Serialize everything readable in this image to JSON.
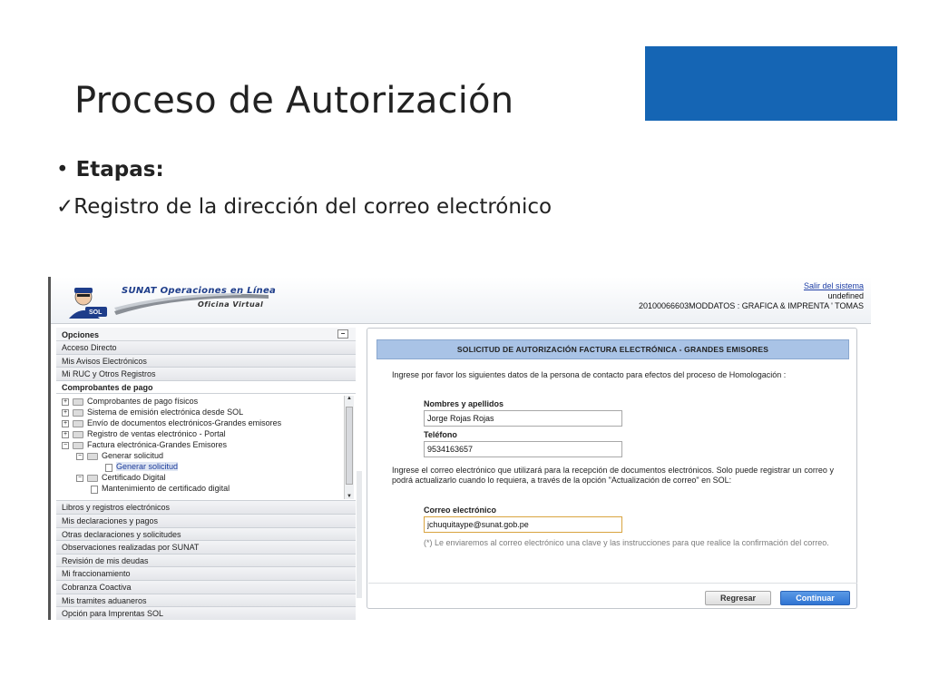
{
  "slide": {
    "title": "Proceso de Autorización",
    "bullet_label": "Etapas:",
    "check_text": "Registro de la dirección del correo electrónico",
    "accent_color": "#1565b4"
  },
  "header": {
    "logo_title": "SUNAT Operaciones en Línea",
    "logo_subtitle": "Oficina Virtual",
    "logo_badge": "SOL",
    "exit_link": "Salir del sistema",
    "line2": "undefined",
    "line3": "20100066603MODDATOS : GRAFICA & IMPRENTA ' TOMAS"
  },
  "sidebar": {
    "heading": "Opciones",
    "collapse_symbol": "−",
    "items_top": [
      "Acceso Directo",
      "Mis Avisos Electrónicos",
      "Mi RUC y Otros Registros"
    ],
    "active_section": "Comprobantes de pago",
    "tree": [
      {
        "label": "Comprobantes de pago físicos",
        "exp": "+"
      },
      {
        "label": "Sistema de emisión electrónica desde SOL",
        "exp": "+"
      },
      {
        "label": "Envío de documentos electrónicos-Grandes emisores",
        "exp": "+"
      },
      {
        "label": "Registro de ventas electrónico - Portal",
        "exp": "+"
      },
      {
        "label": "Factura electrónica-Grandes Emisores",
        "exp": "−"
      },
      {
        "label": "Generar solicitud",
        "exp": "−"
      },
      {
        "label": "Generar solicitud",
        "exp": ""
      },
      {
        "label": "Certificado Digital",
        "exp": "−"
      },
      {
        "label": "Mantenimiento de certificado digital",
        "exp": ""
      }
    ],
    "items_bottom": [
      "Libros y registros electrónicos",
      "Mis declaraciones y pagos",
      "Otras declaraciones y solicitudes",
      "Observaciones realizadas por SUNAT",
      "Revisión de mis deudas",
      "Mi fraccionamiento",
      "Cobranza Coactiva",
      "Mis tramites aduaneros",
      "Opción para Imprentas SOL"
    ]
  },
  "form": {
    "title": "SOLICITUD DE AUTORIZACIÓN FACTURA ELECTRÓNICA - GRANDES EMISORES",
    "intro": "Ingrese por favor los siguientes datos de la persona de contacto para efectos del proceso de Homologación :",
    "name_label": "Nombres y apellidos",
    "name_value": "Jorge Rojas Rojas",
    "phone_label": "Teléfono",
    "phone_value": "9534163657",
    "email_intro": "Ingrese el correo electrónico que utilizará para la recepción de documentos electrónicos. Solo puede registrar un correo y podrá actualizarlo cuando lo requiera, a través de la opción \"Actualización de correo\" en SOL:",
    "email_label": "Correo electrónico",
    "email_value": "jchuquitaype@sunat.gob.pe",
    "note": "(*) Le enviaremos al correo electrónico una clave y las instrucciones para que realice la confirmación del correo.",
    "back_button": "Regresar",
    "continue_button": "Continuar"
  }
}
